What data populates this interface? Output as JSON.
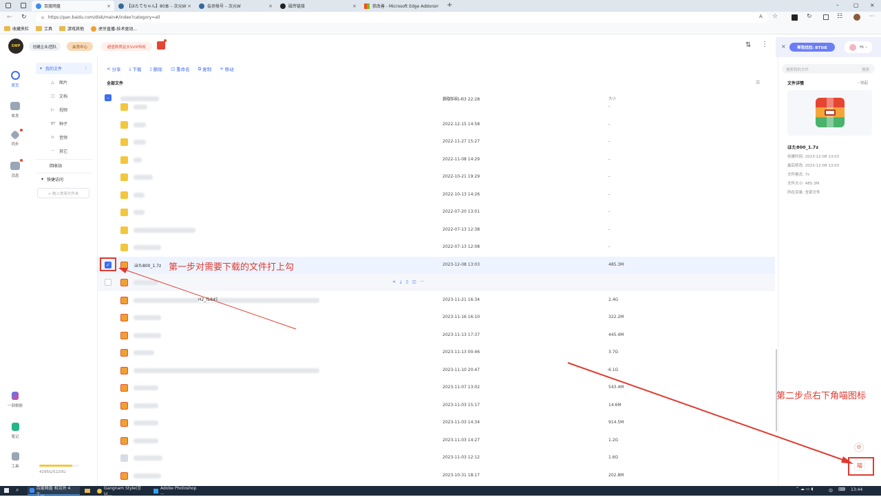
{
  "browser": {
    "tabs": [
      {
        "label": "百度网盘",
        "active": true
      },
      {
        "label": "【ほたてちゃん】80本 – 次元W"
      },
      {
        "label": "会员帐号 – 次元W"
      },
      {
        "label": "磁传链接"
      },
      {
        "label": "获改善 - Microsoft Edge Addons"
      }
    ],
    "new_tab": "+",
    "url": "https://pan.baidu.com/disk/main#/index?category=all",
    "favorites": [
      "收藏夹栏",
      "工具",
      "游戏其他",
      "虎牙直播-技术驱动..."
    ]
  },
  "header": {
    "logo_text": "SWP",
    "btn_enterprise": "创建企业/团队",
    "btn_member": "会员中心",
    "btn_promo": "超值购買延长SVIP特权",
    "helper_label": "帮我找找: BT5IE",
    "hi_label": "Hi"
  },
  "rail": {
    "items": [
      {
        "label": "首页",
        "icon": "home-icon"
      },
      {
        "label": "收发",
        "icon": "inbox-icon"
      },
      {
        "label": "同步",
        "icon": "sync-icon"
      },
      {
        "label": "消息",
        "icon": "message-icon"
      },
      {
        "label": "一刻相册",
        "icon": "album-icon"
      },
      {
        "label": "笔记",
        "icon": "note-icon"
      },
      {
        "label": "工具",
        "icon": "tools-icon"
      }
    ],
    "storage": "4295G/5220G"
  },
  "nav": {
    "my_files": "我的文件",
    "subs": [
      {
        "glyph": "△",
        "label": "图片"
      },
      {
        "glyph": "▢",
        "label": "文档"
      },
      {
        "glyph": "▷",
        "label": "视频"
      },
      {
        "glyph": "BT",
        "label": "种子"
      },
      {
        "glyph": "∩",
        "label": "音频"
      },
      {
        "glyph": "···",
        "label": "其它"
      }
    ],
    "recycle": "回收站",
    "quick": "快捷访问",
    "add_folder": "+ 拖入常用文件夹"
  },
  "toolbar": {
    "share": "分享",
    "download": "下载",
    "delete": "删除",
    "rename": "重命名",
    "copy": "复制",
    "move": "移动"
  },
  "list": {
    "title": "全部文件",
    "col_date": "修改时间",
    "col_size": "大小",
    "rows": [
      {
        "type": "folder",
        "date": "2023-01-03 22:28",
        "size": "-",
        "w": 20
      },
      {
        "type": "folder",
        "date": "2022-12-15 14:58",
        "size": "-",
        "w": 18
      },
      {
        "type": "folder",
        "date": "2022-11-27 15:27",
        "size": "-",
        "w": 18
      },
      {
        "type": "folder",
        "date": "2022-11-08 14:29",
        "size": "-",
        "w": 12
      },
      {
        "type": "folder",
        "date": "2022-10-21 19:29",
        "size": "-",
        "w": 28
      },
      {
        "type": "folder",
        "date": "2022-10-13 14:26",
        "size": "-",
        "w": 16
      },
      {
        "type": "folder",
        "date": "2022-07-20 13:01",
        "size": "-",
        "w": 16
      },
      {
        "type": "folder",
        "date": "2022-07-13 12:38",
        "size": "-",
        "w": 90
      },
      {
        "type": "folder",
        "date": "2022-07-13 12:08",
        "size": "-",
        "w": 40
      },
      {
        "type": "zip",
        "name": "ほた800_1.7z",
        "date": "2023-12-08 13:03",
        "size": "485.3M",
        "checked": true
      },
      {
        "type": "zip",
        "date": "",
        "size": "",
        "w": 36,
        "hover": true
      },
      {
        "type": "zip",
        "date": "2023-11-21 16:34",
        "size": "2.4G",
        "w": 270,
        "inline": "H2_fb845"
      },
      {
        "type": "zip",
        "date": "2023-11-16 16:10",
        "size": "322.2M",
        "w": 40
      },
      {
        "type": "zip",
        "date": "2023-11-13 17:37",
        "size": "445.4M",
        "w": 40
      },
      {
        "type": "zip",
        "date": "2023-11-13 00:46",
        "size": "3.7G",
        "w": 30
      },
      {
        "type": "zip",
        "date": "2023-11-10 20:47",
        "size": "6.1G",
        "w": 270
      },
      {
        "type": "zip",
        "date": "2023-11-07 13:02",
        "size": "543.4M",
        "w": 36
      },
      {
        "type": "zip",
        "date": "2023-11-03 15:17",
        "size": "14.6M",
        "w": 36
      },
      {
        "type": "zip",
        "date": "2023-11-03 14:34",
        "size": "914.5M",
        "w": 36
      },
      {
        "type": "zip",
        "date": "2023-11-03 14:27",
        "size": "1.2G",
        "w": 36
      },
      {
        "type": "doc",
        "date": "2023-11-03 12:12",
        "size": "1.6G",
        "w": 42
      },
      {
        "type": "zip",
        "date": "2023-10-31 18:17",
        "size": "202.8M",
        "w": 40
      }
    ]
  },
  "right": {
    "search_placeholder": "搜索我的文件",
    "search_btn": "搜索",
    "details_title": "文件详情",
    "collapse": "收起",
    "file_name": "ほた800_1.7z",
    "created": "创建时间: 2023-12-08 13:03",
    "modified": "最后修改: 2023-12-08 13:03",
    "format": "文件格式: 7z",
    "filesize": "文件大小: 485.3M",
    "location": "所在目录: 全部文件",
    "meow_btn": "喵"
  },
  "annotations": {
    "step1": "第一步对需要下载的文件打上勾",
    "step2": "第二步点右下角喵图标"
  },
  "taskbar": {
    "tasks": [
      "百度网盘 和另外 4 个...",
      "",
      "Gangnam Style(강남...",
      "Adobe Photoshop ..."
    ],
    "ime": "中",
    "time": "13:44"
  },
  "colors": {
    "accent": "#3c6ef0",
    "annotation": "#e03a2f"
  }
}
